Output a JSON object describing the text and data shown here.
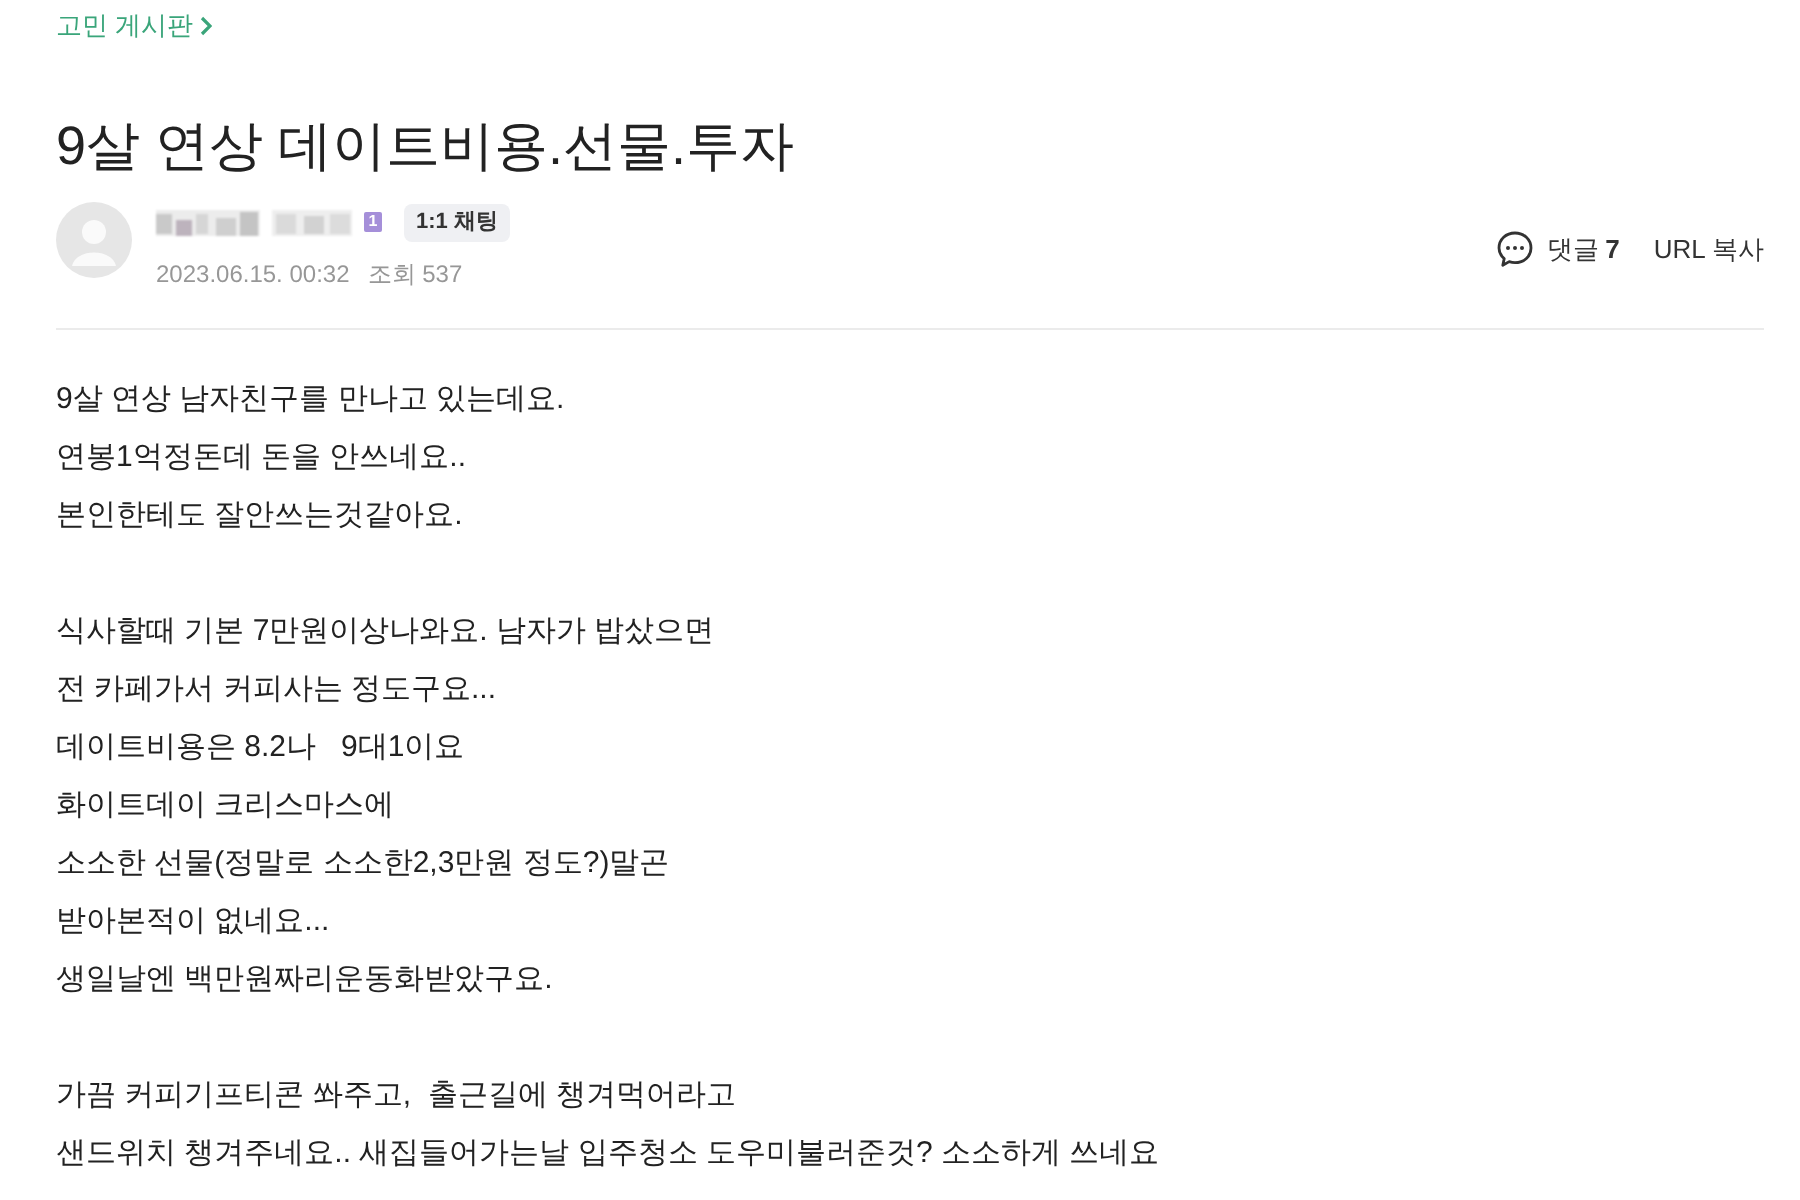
{
  "breadcrumb": {
    "label": "고민 게시판"
  },
  "title": "9살 연상 데이트비용.선물.투자",
  "author": {
    "badge": "1",
    "chat_button": "1:1 채팅",
    "date": "2023.06.15. 00:32",
    "views_label": "조회",
    "views": "537"
  },
  "actions": {
    "comments": {
      "label": "댓글",
      "count": "7"
    },
    "copy_url": "URL 복사"
  },
  "body": {
    "paragraphs": [
      [
        "9살 연상 남자친구를 만나고 있는데요.",
        "연봉1억정돈데 돈을 안쓰네요..",
        "본인한테도 잘안쓰는것같아요."
      ],
      [
        "식사할때 기본 7만원이상나와요. 남자가 밥샀으면",
        "전 카페가서 커피사는 정도구요...",
        "데이트비용은 8.2나   9대1이요",
        "화이트데이 크리스마스에",
        "소소한 선물(정말로 소소한2,3만원 정도?)말곤",
        "받아본적이 없네요...",
        "생일날엔 백만원짜리운동화받았구요."
      ],
      [
        "가끔 커피기프티콘 쏴주고,  출근길에 챙겨먹어라고",
        "샌드위치 챙겨주네요.. 새집들어가는날 입주청소 도우미불러준것? 소소하게 쓰네요"
      ]
    ]
  }
}
